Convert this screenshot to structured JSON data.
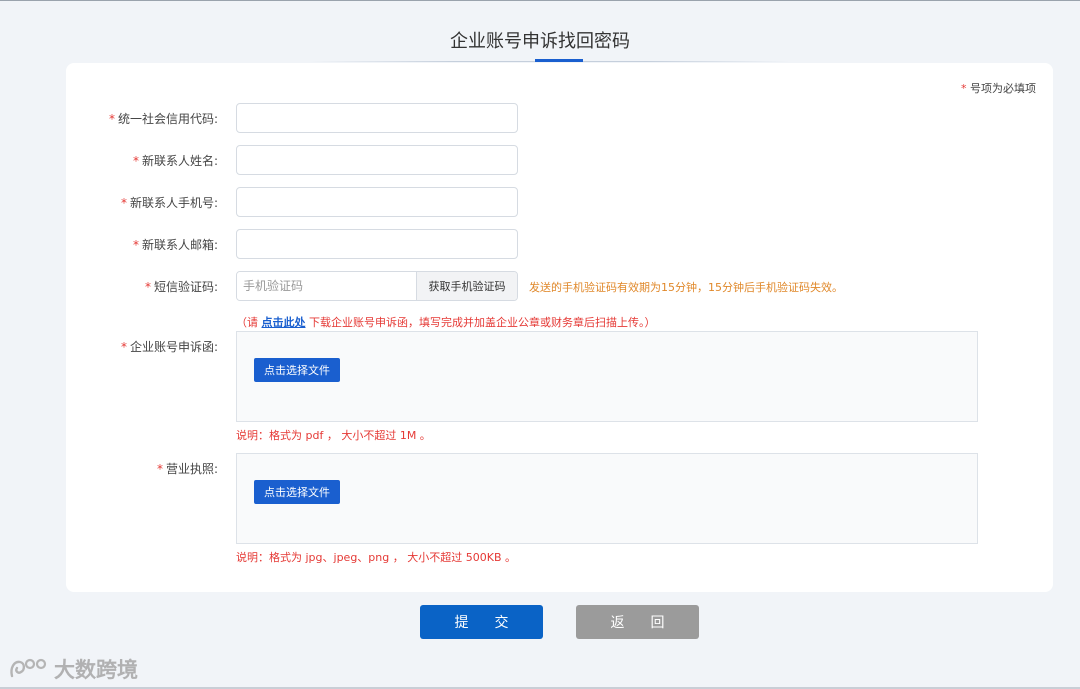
{
  "page": {
    "title": "企业账号申诉找回密码"
  },
  "form": {
    "required_note": "号项为必填项",
    "fields": [
      {
        "label": "统一社会信用代码:",
        "value": ""
      },
      {
        "label": "新联系人姓名:",
        "value": ""
      },
      {
        "label": "新联系人手机号:",
        "value": ""
      },
      {
        "label": "新联系人邮箱:",
        "value": ""
      }
    ],
    "sms": {
      "label": "短信验证码:",
      "placeholder": "手机验证码",
      "button": "获取手机验证码",
      "hint": "发送的手机验证码有效期为15分钟，15分钟后手机验证码失效。"
    },
    "appeal": {
      "note_prefix": "（请 ",
      "note_link": "点击此处",
      "note_suffix": " 下载企业账号申诉函，填写完成并加盖企业公章或财务章后扫描上传。）",
      "label": "企业账号申诉函:",
      "button": "点击选择文件",
      "explain": "说明：格式为 pdf ， 大小不超过 1M 。"
    },
    "license": {
      "label": "营业执照:",
      "button": "点击选择文件",
      "explain": "说明：格式为 jpg、jpeg、png ， 大小不超过 500KB 。"
    }
  },
  "actions": {
    "submit": "提交",
    "back": "返回"
  },
  "watermark": {
    "text": "大数跨境"
  },
  "colors": {
    "primary": "#1a5fcf",
    "submit": "#0a63c6",
    "back": "#9b9b9b",
    "required": "#e53935",
    "hint": "#e0882a"
  }
}
